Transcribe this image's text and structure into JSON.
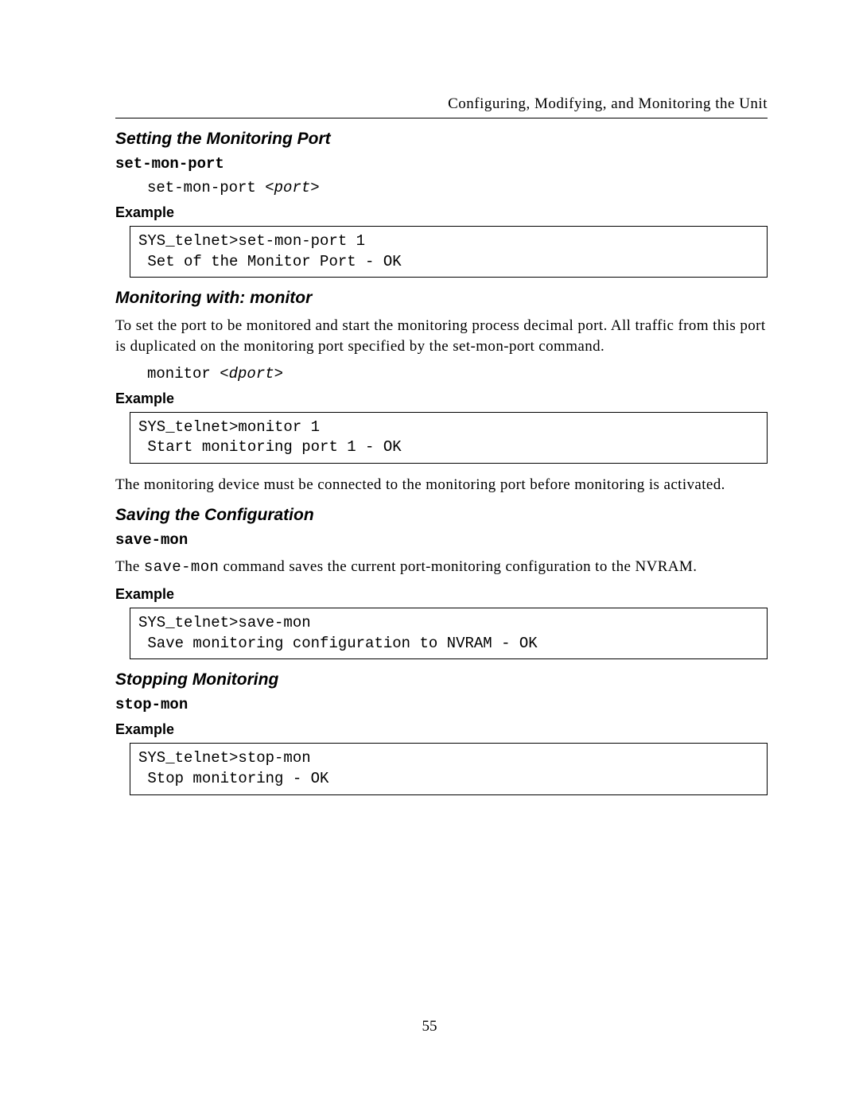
{
  "header": {
    "running_title": "Configuring, Modifying, and Monitoring the Unit"
  },
  "sections": {
    "setting_port": {
      "heading": "Setting the Monitoring Port",
      "command": "set-mon-port",
      "syntax_prefix": "set-mon-port ",
      "syntax_arg": "<port>",
      "example_label": "Example",
      "example_code": "SYS_telnet>set-mon-port 1\n Set of the Monitor Port - OK"
    },
    "monitoring": {
      "heading": "Monitoring with: monitor",
      "intro": "To set the port to be monitored and start the monitoring process decimal port.  All traffic from this port is duplicated on the monitoring port specified by the set-mon-port command.",
      "syntax_prefix": "monitor ",
      "syntax_arg": "<dport>",
      "example_label": "Example",
      "example_code": "SYS_telnet>monitor 1\n Start monitoring port 1 - OK",
      "note": "The monitoring device must be connected to the monitoring port before monitoring is activated."
    },
    "saving": {
      "heading": "Saving the Configuration",
      "command": "save-mon",
      "intro_pre": "The ",
      "intro_mono": "save-mon",
      "intro_post": " command saves the current port-monitoring configuration to the NVRAM.",
      "example_label": "Example",
      "example_code": "SYS_telnet>save-mon\n Save monitoring configuration to NVRAM - OK"
    },
    "stopping": {
      "heading": "Stopping Monitoring",
      "command": "stop-mon",
      "example_label": "Example",
      "example_code": "SYS_telnet>stop-mon\n Stop monitoring - OK"
    }
  },
  "page_number": "55"
}
